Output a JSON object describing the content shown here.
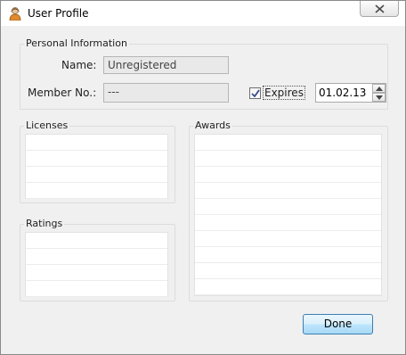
{
  "window": {
    "title": "User Profile"
  },
  "personal": {
    "group_label": "Personal Information",
    "name_label": "Name:",
    "name_value": "Unregistered",
    "member_label": "Member No.:",
    "member_value": "---",
    "expires_label": "Expires",
    "expires_checked": true,
    "expires_value": "01.02.13"
  },
  "licenses": {
    "label": "Licenses",
    "rows": 4
  },
  "ratings": {
    "label": "Ratings",
    "rows": 4
  },
  "awards": {
    "label": "Awards",
    "rows": 10
  },
  "actions": {
    "done_label": "Done"
  },
  "icons": {
    "title": "user-icon",
    "close": "close-icon",
    "check": "checkmark-icon",
    "up": "spin-up-icon",
    "down": "spin-down-icon"
  }
}
